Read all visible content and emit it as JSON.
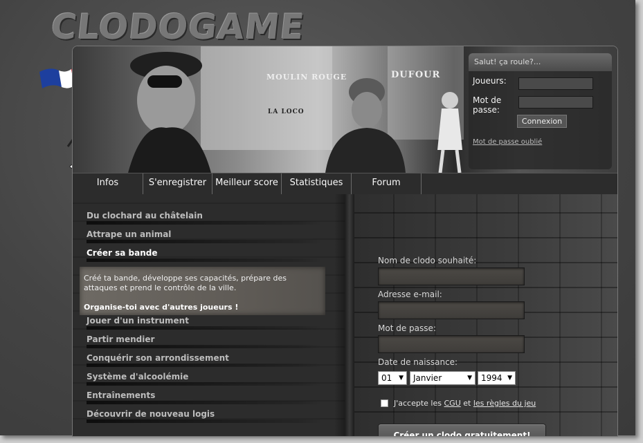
{
  "header": {
    "logo_text": "CLODOGAME"
  },
  "login": {
    "greeting": "Salut! ça roule?...",
    "players_label": "Joueurs:",
    "password_label_1": "Mot de",
    "password_label_2": "passe:",
    "button": "Connexion",
    "forgot": "Mot de passe oublié"
  },
  "nav": {
    "items": [
      "Infos",
      "S'enregistrer",
      "Meilleur score",
      "Statistiques",
      "Forum"
    ]
  },
  "features": {
    "items": [
      "Du clochard au châtelain",
      "Attrape un animal",
      "Créer sa bande",
      "Jouer d'un instrument",
      "Partir mendier",
      "Conquérir son arrondissement",
      "Système d'alcoolémie",
      "Entraînements",
      "Découvrir de nouveau logis"
    ],
    "active_index": 2,
    "description": "Créé ta bande, développe ses capacités, prépare des attaques et prend le contrôle de la ville.",
    "cta": "Organise-toi avec d'autres joueurs !"
  },
  "register": {
    "name_label": "Nom de clodo souhaité:",
    "email_label": "Adresse e-mail:",
    "password_label": "Mot de passe:",
    "birth_label": "Date de naissance:",
    "day": "01",
    "month": "Janvier",
    "year": "1994",
    "terms_prefix": "J'accepte les",
    "terms_cgu": "CGU",
    "terms_and": "et",
    "terms_rules": "les règles du jeu",
    "button": "Créer un clodo gratuitement!"
  },
  "banner_signs": {
    "moulin": "MOULIN ROUGE",
    "dufour": "DUFOUR",
    "loco": "LA LOCO"
  },
  "colors": {
    "background": "#444444",
    "accent": "#cccccc"
  }
}
